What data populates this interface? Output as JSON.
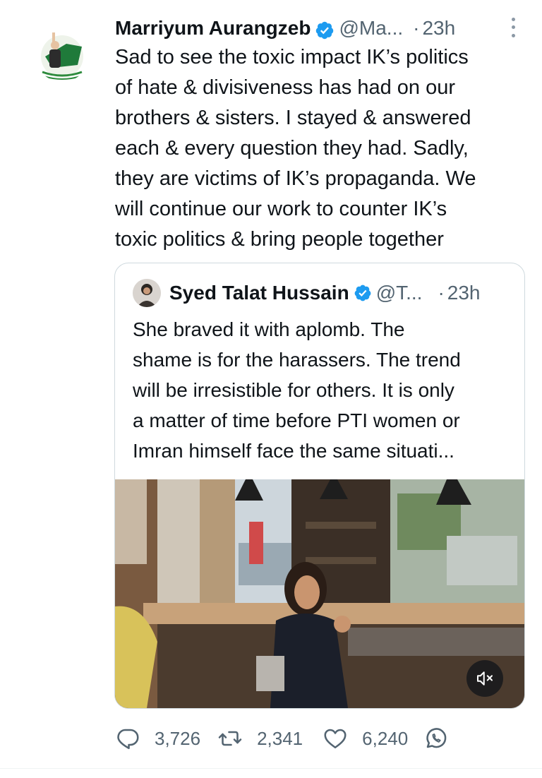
{
  "tweet": {
    "author_name": "Marriyum Aurangzeb",
    "handle": "@Ma...",
    "separator": "·",
    "time": "23h",
    "body_lines": [
      "Sad to see the toxic impact IK’s politics",
      "of hate & divisiveness has had on our",
      "brothers & sisters. I stayed & answered",
      "each & every question they had. Sadly,",
      "they are victims of IK’s propaganda. We",
      "will continue our work to counter IK’s",
      "toxic politics & bring people together"
    ]
  },
  "quoted_tweet": {
    "author_name": "Syed Talat Hussain",
    "handle": "@T...",
    "separator": "·",
    "time": "23h",
    "body_lines": [
      "She braved it with aplomb. The",
      "shame is for the harassers. The trend",
      "will be irresistible for others. It is only",
      "a matter of time before PTI women or",
      "Imran himself face the same situati..."
    ]
  },
  "actions": {
    "replies": "3,726",
    "retweets": "2,341",
    "likes": "6,240"
  },
  "icons": {
    "verified": "verified-badge-icon",
    "more": "more-options-icon",
    "reply": "reply-icon",
    "retweet": "retweet-icon",
    "like": "heart-icon",
    "share": "whatsapp-share-icon",
    "mute": "volume-muted-icon"
  },
  "colors": {
    "verified_blue": "#1d9bf0",
    "text_primary": "#0f1419",
    "text_secondary": "#536471",
    "border": "#cfd9de"
  }
}
